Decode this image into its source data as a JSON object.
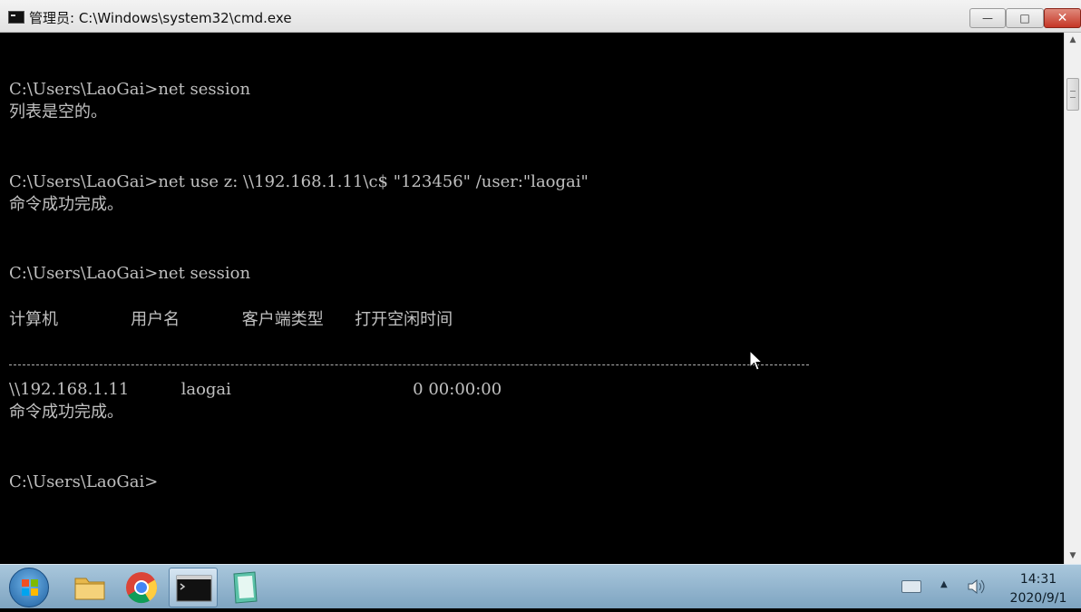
{
  "window": {
    "title": "管理员: C:\\Windows\\system32\\cmd.exe",
    "minimize_glyph": "—",
    "maximize_glyph": "□",
    "close_glyph": "✕"
  },
  "console": {
    "lines": [
      "C:\\Users\\LaoGai>net session",
      "列表是空的。",
      "C:\\Users\\LaoGai>net use z: \\\\192.168.1.11\\c$ \"123456\" /user:\"laogai\"",
      "命令成功完成。",
      "C:\\Users\\LaoGai>net session",
      "计算机              用户名            客户端类型      打开空闲时间",
      "\\\\192.168.1.11          laogai                                   0 00:00:00",
      "命令成功完成。",
      "C:\\Users\\LaoGai>"
    ]
  },
  "scrollbar": {
    "up_glyph": "▲",
    "down_glyph": "▼"
  },
  "taskbar": {
    "apps": [
      "folder-icon",
      "chrome-icon",
      "cmd-icon",
      "notepad-icon"
    ],
    "tray_arrow": "▲",
    "clock_time": "14:31",
    "clock_date": "2020/9/1"
  },
  "colors": {
    "console_bg": "#000000",
    "console_text": "#c0c0c0",
    "close_button": "#c53626",
    "taskbar": "#8fb2cc"
  }
}
